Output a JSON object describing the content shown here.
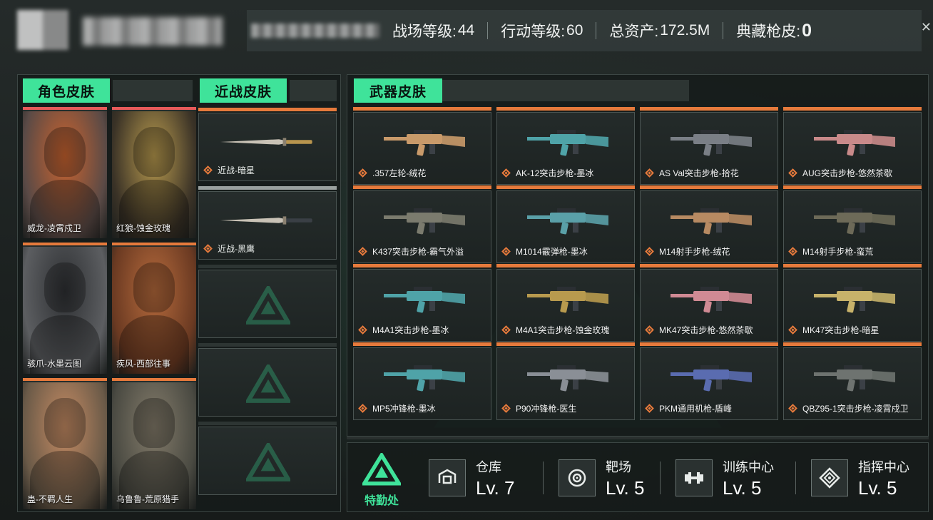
{
  "header": {
    "stats": [
      {
        "label": "战场等级:",
        "value": "44"
      },
      {
        "label": "行动等级:",
        "value": "60"
      },
      {
        "label": "总资产:",
        "value": "172.5M"
      },
      {
        "label": "典藏枪皮:",
        "value": "0"
      }
    ]
  },
  "tabs": {
    "character": "角色皮肤",
    "melee": "近战皮肤",
    "weapon": "武器皮肤"
  },
  "characters": [
    {
      "label": "威龙-凌霄戍卫",
      "rarity_color": "#e85a5a",
      "tint": [
        "#5a4a46",
        "#c9632f"
      ]
    },
    {
      "label": "红狼-蚀金玫瑰",
      "rarity_color": "#e85a5a",
      "tint": [
        "#3b3327",
        "#b89a4e"
      ]
    },
    {
      "label": "骇爪-水墨云图",
      "rarity_color": "#e67a3c",
      "tint": [
        "#5c5e61",
        "#2e3033"
      ]
    },
    {
      "label": "疾风-西部往事",
      "rarity_color": "#e67a3c",
      "tint": [
        "#6b3a22",
        "#b56a3c"
      ]
    },
    {
      "label": "蛊-不羁人生",
      "rarity_color": "#e67a3c",
      "tint": [
        "#6a5a48",
        "#c58b63"
      ]
    },
    {
      "label": "乌鲁鲁-荒原猎手",
      "rarity_color": "#e67a3c",
      "tint": [
        "#4a4a42",
        "#837b6a"
      ]
    }
  ],
  "melee": [
    {
      "label": "近战-暗星",
      "rarity_color": "#e67a3c"
    },
    {
      "label": "近战-黑鹰",
      "rarity_color": "#9aa19f"
    },
    {
      "label": "",
      "rarity_color": "#2d3533"
    },
    {
      "label": "",
      "rarity_color": "#2d3533"
    },
    {
      "label": "",
      "rarity_color": "#2d3533"
    }
  ],
  "weapons": [
    {
      "label": ".357左轮-绒花",
      "color": "#c99a6a"
    },
    {
      "label": "AK-12突击步枪-墨冰",
      "color": "#4fa3a8"
    },
    {
      "label": "AS Val突击步枪-拾花",
      "color": "#7a7f86"
    },
    {
      "label": "AUG突击步枪-悠然茶歇",
      "color": "#c98a8a"
    },
    {
      "label": "K437突击步枪-霸气外溢",
      "color": "#7b7b6e"
    },
    {
      "label": "M1014霰弹枪-墨冰",
      "color": "#5aa0a8"
    },
    {
      "label": "M14射手步枪-绒花",
      "color": "#b78a62"
    },
    {
      "label": "M14射手步枪-蛮荒",
      "color": "#6d6a58"
    },
    {
      "label": "M4A1突击步枪-墨冰",
      "color": "#4fa3a8"
    },
    {
      "label": "M4A1突击步枪-蚀金玫瑰",
      "color": "#b89a4e"
    },
    {
      "label": "MK47突击步枪-悠然茶歇",
      "color": "#d08a94"
    },
    {
      "label": "MK47突击步枪-暗星",
      "color": "#c7b26a"
    },
    {
      "label": "MP5冲锋枪-墨冰",
      "color": "#4fa3a8"
    },
    {
      "label": "P90冲锋枪-医生",
      "color": "#8a8f96"
    },
    {
      "label": "PKM通用机枪-盾峰",
      "color": "#5a6cb0"
    },
    {
      "label": "QBZ95-1突击步枪-凌霄戍卫",
      "color": "#6e7370"
    }
  ],
  "facilities": {
    "logo_label": "特勤处",
    "items": [
      {
        "name": "仓库",
        "level": "Lv. 7",
        "icon": "warehouse-icon"
      },
      {
        "name": "靶场",
        "level": "Lv. 5",
        "icon": "target-icon"
      },
      {
        "name": "训练中心",
        "level": "Lv. 5",
        "icon": "dumbbell-icon"
      },
      {
        "name": "指挥中心",
        "level": "Lv. 5",
        "icon": "command-icon"
      }
    ]
  },
  "colors": {
    "accent": "#3fe39a",
    "gold_rarity": "#e67a3c",
    "red_rarity": "#e85a5a"
  }
}
